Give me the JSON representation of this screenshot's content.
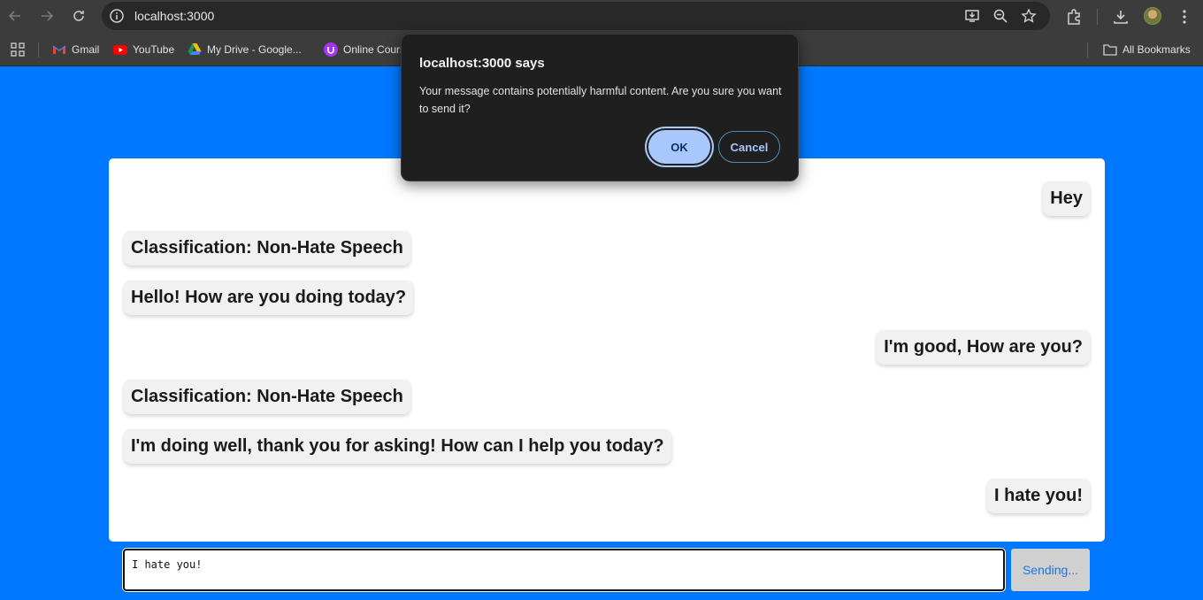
{
  "browser": {
    "url": "localhost:3000",
    "bookmarks": [
      {
        "label": "Gmail",
        "icon": "gmail-icon"
      },
      {
        "label": "YouTube",
        "icon": "youtube-icon"
      },
      {
        "label": "My Drive - Google...",
        "icon": "drive-icon"
      },
      {
        "label": "Online Cours",
        "icon": "course-icon"
      }
    ],
    "all_bookmarks": "All Bookmarks"
  },
  "chat": {
    "messages": [
      {
        "sender": "user",
        "text": "Hey"
      },
      {
        "sender": "bot",
        "text": "Classification: Non-Hate Speech"
      },
      {
        "sender": "bot",
        "text": "Hello! How are you doing today?"
      },
      {
        "sender": "user",
        "text": "I'm good, How are you?"
      },
      {
        "sender": "bot",
        "text": "Classification: Non-Hate Speech"
      },
      {
        "sender": "bot",
        "text": "I'm doing well, thank you for asking! How can I help you today?"
      },
      {
        "sender": "user",
        "text": "I hate you!"
      }
    ],
    "input_value": "I hate you!",
    "send_label": "Sending..."
  },
  "dialog": {
    "title": "localhost:3000 says",
    "message": "Your message contains potentially harmful content. Are you sure you want to send it?",
    "ok_label": "OK",
    "cancel_label": "Cancel"
  },
  "colors": {
    "page_background": "#0078ff",
    "dialog_ok": "#a8c7fa"
  }
}
